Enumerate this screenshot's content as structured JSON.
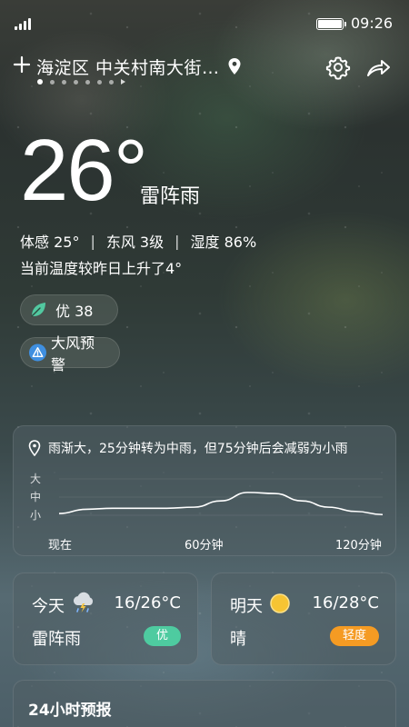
{
  "status_bar": {
    "time": "09:26",
    "battery_level": 1.0
  },
  "header": {
    "location": "海淀区 中关村南大街…",
    "page_count": 7,
    "active_page": 0
  },
  "current": {
    "temperature": "26°",
    "condition": "雷阵雨",
    "feels_like": "体感 25°",
    "wind": "东风 3级",
    "humidity": "湿度 86%",
    "separator": "|",
    "comparison": "当前温度较昨日上升了4°"
  },
  "aqi_pill": {
    "label": "优 38"
  },
  "alert_pill": {
    "label": "大风预警"
  },
  "precip": {
    "summary": "雨渐大，25分钟转为中雨，但75分钟后会减弱为小雨",
    "y_levels": [
      "大",
      "中",
      "小"
    ],
    "x_labels": [
      "现在",
      "60分钟",
      "120分钟"
    ],
    "chart_data": {
      "type": "line",
      "x": [
        0,
        10,
        20,
        30,
        40,
        50,
        60,
        70,
        80,
        90,
        100,
        110,
        120
      ],
      "values": [
        1.1,
        1.3,
        1.35,
        1.35,
        1.35,
        1.4,
        1.7,
        2.1,
        2.05,
        1.7,
        1.4,
        1.2,
        1.05
      ],
      "ylim": [
        0.5,
        3.0
      ],
      "xlim": [
        0,
        120
      ],
      "color": "#ffffff"
    }
  },
  "forecast": {
    "today": {
      "name": "今天",
      "icon": "thunderstorm-icon",
      "range": "16/26°C",
      "condition": "雷阵雨",
      "badge": "优",
      "badge_color": "#4ecba0"
    },
    "tomorrow": {
      "name": "明天",
      "icon": "sun-icon",
      "range": "16/28°C",
      "condition": "晴",
      "badge": "轻度",
      "badge_color": "#f59b23"
    }
  },
  "hourly": {
    "title": "24小时预报"
  }
}
